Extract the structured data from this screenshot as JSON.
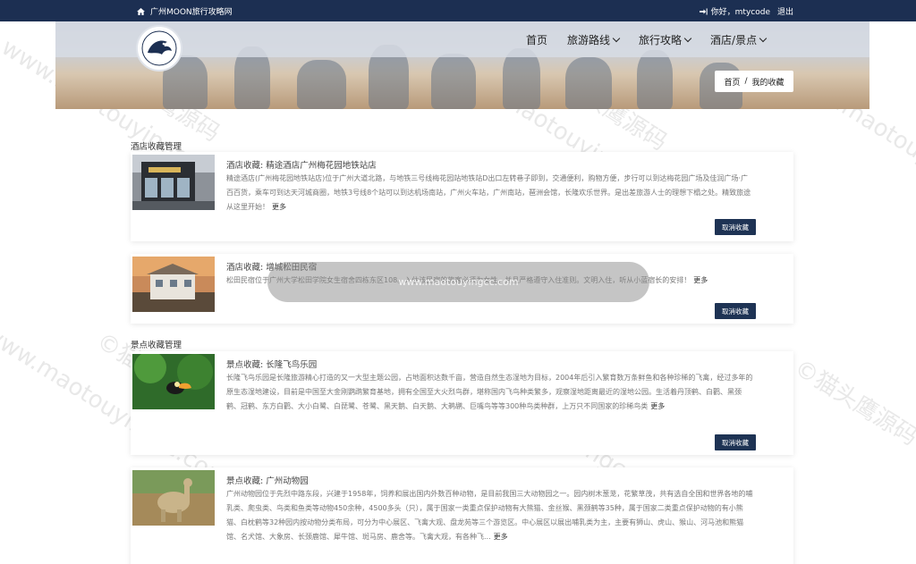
{
  "topbar": {
    "site_name": "广州MOON旅行攻略网",
    "greeting": "你好，mtycode",
    "logout": "退出"
  },
  "nav": {
    "items": [
      "首页",
      "旅游路线",
      "旅行攻略",
      "酒店/景点"
    ]
  },
  "breadcrumb": {
    "home": "首页",
    "sep": "/",
    "current": "我的收藏"
  },
  "hotel_section": {
    "title": "酒店收藏管理",
    "items": [
      {
        "title": "酒店收藏: 精途酒店广州梅花园地铁站店",
        "desc": "精途酒店(广州梅花园地铁站店)位于广州大道北路，与地铁三号线梅花园站地铁站D出口左转巷子即到，交通便利，购物方便，步行可以到达梅花园广场及佳润广场·广百百货，乘车可到达天河城商圈，地铁3号线8个站可以到达机场南站，广州火车站，广州南站，琶洲会馆，长隆欢乐世界。是出差旅游人士的理想下榻之处。精致旅途从这里开始！",
        "more": "更多",
        "button": "取消收藏"
      },
      {
        "title": "酒店收藏: 增城松田民宿",
        "desc": "松田民宿位于广州大学松田学院女生宿舍四栋东区108。入住该民宿的旅客必须为女性，并且严格遵守入住准则。文明入住，听从小蓝宿长的安排！",
        "more": "更多",
        "button": "取消收藏"
      }
    ]
  },
  "scenic_section": {
    "title": "景点收藏管理",
    "items": [
      {
        "title": "景点收藏: 长隆飞鸟乐园",
        "desc": "长隆飞鸟乐园是长隆旅游精心打造的又一大型主题公园，占地面积达数千亩，营造自然生态湿地为目标，2004年后引入繁育数万条鲜鱼和各种珍稀的飞禽，经过多年的原生态湿地建设，目前是中国至大金刚鹦鹉繁育基地，拥有全国至大火烈鸟群，堪称国内飞鸟种类繁多，观察湿地距离最近的湿地公园。生活着丹顶鹤、白鹳、黑颈鹤、冠鹤、东方白鹳、大小白鹭、白琵鹭、苍鹭、黑天鹅、白天鹅、大鹈鹕、巨嘴鸟等等300种鸟类种群，上万只不同国家的珍稀鸟类",
        "more": "更多",
        "button": "取消收藏"
      },
      {
        "title": "景点收藏: 广州动物园",
        "desc": "广州动物园位于先烈中路东段，兴建于1958年，饲养和展出国内外数百种动物，是目前我国三大动物园之一。园内树木葱茏，花繁草茂，共有选自全国和世界各地的哺乳类、爬虫类、鸟类和鱼类等动物450余种，4500多头（只），属于国家一类重点保护动物有大熊猫、金丝猴、黑颈鹤等35种，属于国家二类重点保护动物的有小熊猫、白枕鹤等32种园内按动物分类布局，可分为中心展区、飞禽大观、盘龙苑等三个游览区。中心展区以展出哺乳类为主，主要有狮山、虎山、猴山、河马池和熊猫馆、名犬馆、大象房、长颈鹿馆、犀牛馆、斑马房、鹿舍等。飞禽大观，有各种飞...",
        "more": "更多",
        "button": "取消收藏"
      }
    ]
  },
  "toast": {
    "text": "www.maotouyingcc.com"
  },
  "watermark": {
    "a": "©猫头鹰源码",
    "b": "www.maotouyingcc.com"
  }
}
